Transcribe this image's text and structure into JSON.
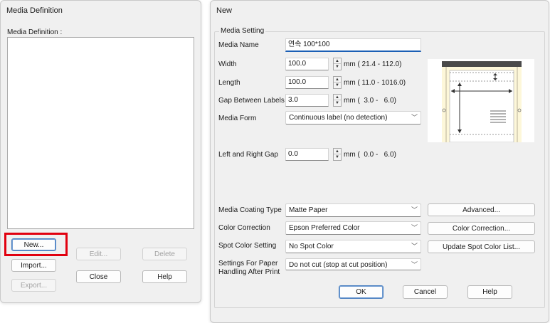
{
  "media_definition_dialog": {
    "title": "Media Definition",
    "list_label": "Media Definition :",
    "buttons": {
      "new": "New...",
      "import": "Import...",
      "export": "Export...",
      "edit": "Edit...",
      "delete": "Delete",
      "close": "Close",
      "help": "Help"
    },
    "highlight_color": "#e1000f"
  },
  "new_dialog": {
    "title": "New",
    "group_label": "Media Setting",
    "media_name": {
      "label": "Media Name",
      "value": "연속 100*100"
    },
    "width": {
      "label": "Width",
      "value": "100.0",
      "range": "mm ( 21.4 - 112.0)"
    },
    "length": {
      "label": "Length",
      "value": "100.0",
      "range": "mm ( 11.0 - 1016.0)"
    },
    "gap_between_labels": {
      "label": "Gap Between Labels",
      "value": "3.0",
      "range": "mm (  3.0 -   6.0)"
    },
    "media_form": {
      "label": "Media Form",
      "value": "Continuous label (no detection)"
    },
    "left_right_gap": {
      "label": "Left and Right Gap",
      "value": "0.0",
      "range": "mm (  0.0 -   6.0)"
    },
    "media_coating_type": {
      "label": "Media Coating Type",
      "value": "Matte Paper"
    },
    "color_correction": {
      "label": "Color Correction",
      "value": "Epson Preferred Color"
    },
    "spot_color_setting": {
      "label": "Spot Color Setting",
      "value": "No Spot Color"
    },
    "paper_handling": {
      "label_line1": "Settings For Paper",
      "label_line2": "Handling After Print",
      "value": "Do not cut (stop at cut position)"
    },
    "buttons": {
      "advanced": "Advanced...",
      "color_correction": "Color Correction...",
      "update_spot_color": "Update Spot Color List...",
      "ok": "OK",
      "cancel": "Cancel",
      "help": "Help"
    },
    "diagram_colors": {
      "media": "#fdf7d9",
      "roller": "#4a4a4a"
    }
  },
  "icons": [
    "spin-up-icon",
    "spin-down-icon",
    "chevron-down-icon"
  ]
}
